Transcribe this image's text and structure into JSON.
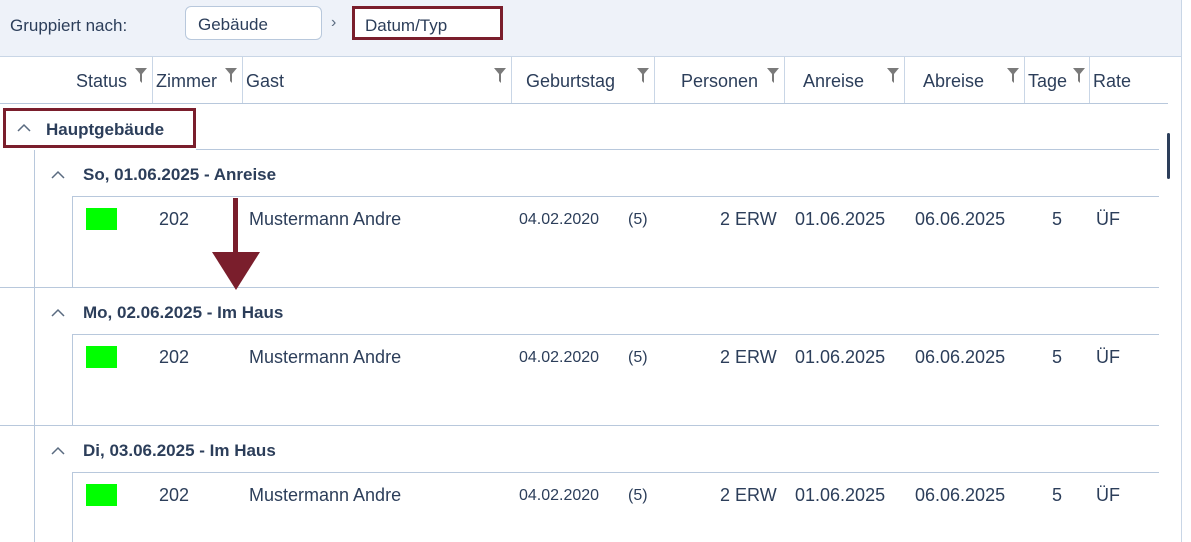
{
  "grouping": {
    "label": "Gruppiert nach:",
    "chips": [
      "Gebäude",
      "Datum/Typ"
    ],
    "separator": "›"
  },
  "columns": {
    "status": "Status",
    "zimmer": "Zimmer",
    "gast": "Gast",
    "geburtstag": "Geburtstag",
    "personen": "Personen",
    "anreise": "Anreise",
    "abreise": "Abreise",
    "tage": "Tage",
    "rate": "Rate"
  },
  "group": {
    "label": "Hauptgebäude",
    "expanded": true,
    "subgroups": [
      {
        "label": "So, 01.06.2025 - Anreise",
        "row": {
          "status_color": "#00ff00",
          "zimmer": "202",
          "gast": "Mustermann Andre",
          "geburtstag": "04.02.2020",
          "alter": "(5)",
          "personen": "2 ERW",
          "anreise": "01.06.2025",
          "abreise": "06.06.2025",
          "tage": "5",
          "rate": "ÜF"
        }
      },
      {
        "label": "Mo, 02.06.2025 - Im Haus",
        "row": {
          "status_color": "#00ff00",
          "zimmer": "202",
          "gast": "Mustermann Andre",
          "geburtstag": "04.02.2020",
          "alter": "(5)",
          "personen": "2 ERW",
          "anreise": "01.06.2025",
          "abreise": "06.06.2025",
          "tage": "5",
          "rate": "ÜF"
        }
      },
      {
        "label": "Di, 03.06.2025 - Im Haus",
        "row": {
          "status_color": "#00ff00",
          "zimmer": "202",
          "gast": "Mustermann Andre",
          "geburtstag": "04.02.2020",
          "alter": "(5)",
          "personen": "2 ERW",
          "anreise": "01.06.2025",
          "abreise": "06.06.2025",
          "tage": "5",
          "rate": "ÜF"
        }
      }
    ]
  },
  "colors": {
    "accent_frame": "#7a1e2c",
    "status_green": "#00ff00",
    "text": "#2c3e5a"
  }
}
